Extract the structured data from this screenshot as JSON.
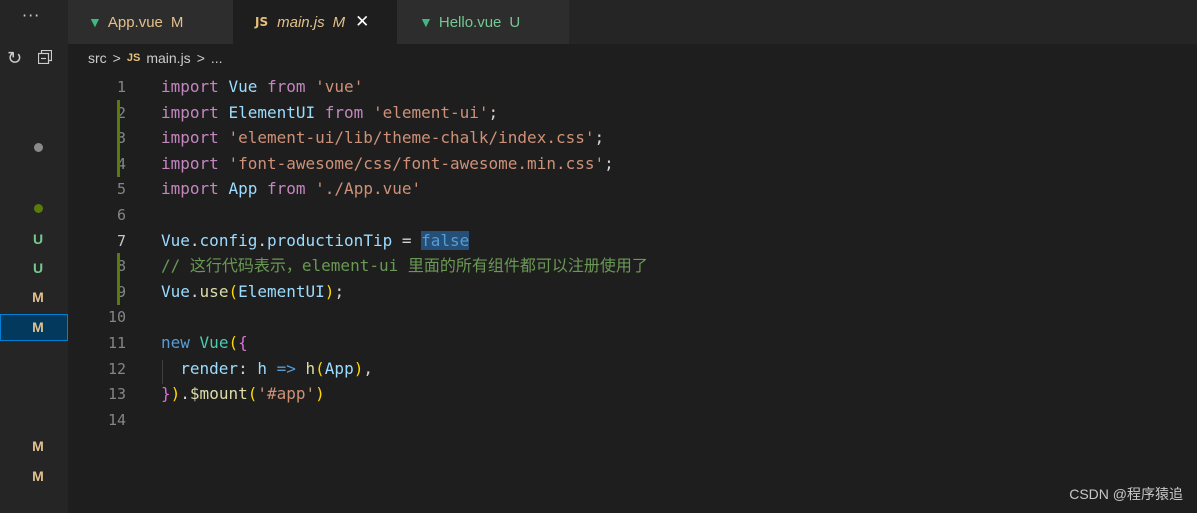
{
  "sidebar": {
    "more_label": "···",
    "refresh_glyph": "↻",
    "scm_decorations": [
      {
        "kind": "dot",
        "color": "#8a8a8a"
      },
      {
        "kind": "dot",
        "color": "#587c0c"
      },
      {
        "kind": "badge",
        "label": "U",
        "color": "#73c991"
      },
      {
        "kind": "badge",
        "label": "U",
        "color": "#73c991"
      },
      {
        "kind": "badge",
        "label": "M",
        "color": "#e2c08d"
      },
      {
        "kind": "badge",
        "label": "M",
        "color": "#e2c08d",
        "selected": true
      },
      {
        "kind": "badge",
        "label": "M",
        "color": "#e2c08d"
      },
      {
        "kind": "badge",
        "label": "M",
        "color": "#e2c08d"
      }
    ]
  },
  "tabs": [
    {
      "icon": "V",
      "label": "App.vue",
      "status": "M",
      "status_color": "#e2c08d",
      "label_color": "#e2c08d",
      "active": false
    },
    {
      "icon": "JS",
      "label": "main.js",
      "status": "M",
      "status_color": "#e2c08d",
      "label_color": "#e2c08d",
      "active": true,
      "close": "✕"
    },
    {
      "icon": "V",
      "label": "Hello.vue",
      "status": "U",
      "status_color": "#73c991",
      "label_color": "#73c991",
      "active": false
    }
  ],
  "breadcrumb": {
    "folder": "src",
    "sep": ">",
    "file_icon": "JS",
    "file": "main.js",
    "tail": "..."
  },
  "editor": {
    "active_line": 7,
    "selection": "false",
    "lines": [
      {
        "n": "1",
        "gutter": false,
        "tokens": [
          [
            "kw",
            "import"
          ],
          [
            "",
            " "
          ],
          [
            "var",
            "Vue"
          ],
          [
            "",
            " "
          ],
          [
            "kw",
            "from"
          ],
          [
            "",
            " "
          ],
          [
            "str",
            "'vue'"
          ]
        ]
      },
      {
        "n": "2",
        "gutter": true,
        "tokens": [
          [
            "kw",
            "import"
          ],
          [
            "",
            " "
          ],
          [
            "var",
            "ElementUI"
          ],
          [
            "",
            " "
          ],
          [
            "kw",
            "from"
          ],
          [
            "",
            " "
          ],
          [
            "str",
            "'element-ui'"
          ],
          [
            "",
            ";"
          ]
        ]
      },
      {
        "n": "3",
        "gutter": true,
        "tokens": [
          [
            "kw",
            "import"
          ],
          [
            "",
            " "
          ],
          [
            "str",
            "'element-ui/lib/theme-chalk/index.css'"
          ],
          [
            "",
            ";"
          ]
        ]
      },
      {
        "n": "4",
        "gutter": true,
        "tokens": [
          [
            "kw",
            "import"
          ],
          [
            "",
            " "
          ],
          [
            "str",
            "'font-awesome/css/font-awesome.min.css'"
          ],
          [
            "",
            ";"
          ]
        ]
      },
      {
        "n": "5",
        "gutter": false,
        "tokens": [
          [
            "kw",
            "import"
          ],
          [
            "",
            " "
          ],
          [
            "var",
            "App"
          ],
          [
            "",
            " "
          ],
          [
            "kw",
            "from"
          ],
          [
            "",
            " "
          ],
          [
            "str",
            "'./App.vue'"
          ]
        ]
      },
      {
        "n": "6",
        "gutter": false,
        "tokens": []
      },
      {
        "n": "7",
        "gutter": false,
        "tokens": [
          [
            "var",
            "Vue"
          ],
          [
            "",
            "."
          ],
          [
            "var",
            "config"
          ],
          [
            "",
            "."
          ],
          [
            "var",
            "productionTip"
          ],
          [
            "",
            " = "
          ],
          [
            "bool sel",
            "false"
          ]
        ]
      },
      {
        "n": "8",
        "gutter": true,
        "tokens": [
          [
            "cm",
            "// 这行代码表示，element-ui 里面的所有组件都可以注册使用了"
          ]
        ]
      },
      {
        "n": "9",
        "gutter": true,
        "tokens": [
          [
            "var",
            "Vue"
          ],
          [
            "",
            "."
          ],
          [
            "fn",
            "use"
          ],
          [
            "br1",
            "("
          ],
          [
            "var",
            "ElementUI"
          ],
          [
            "br1",
            ")"
          ],
          [
            "",
            ";"
          ]
        ]
      },
      {
        "n": "10",
        "gutter": false,
        "tokens": []
      },
      {
        "n": "11",
        "gutter": false,
        "tokens": [
          [
            "bool",
            "new"
          ],
          [
            "",
            " "
          ],
          [
            "cls",
            "Vue"
          ],
          [
            "br1",
            "("
          ],
          [
            "br2",
            "{"
          ]
        ]
      },
      {
        "n": "12",
        "gutter": false,
        "tokens": [
          [
            "",
            "  "
          ],
          [
            "var",
            "render"
          ],
          [
            "",
            ": "
          ],
          [
            "var",
            "h"
          ],
          [
            "",
            " "
          ],
          [
            "bool",
            "=>"
          ],
          [
            "",
            " "
          ],
          [
            "fn",
            "h"
          ],
          [
            "br1",
            "("
          ],
          [
            "var",
            "App"
          ],
          [
            "br1",
            ")"
          ],
          [
            "",
            ","
          ]
        ]
      },
      {
        "n": "13",
        "gutter": false,
        "tokens": [
          [
            "br2",
            "}"
          ],
          [
            "br1",
            ")"
          ],
          [
            "",
            "."
          ],
          [
            "fn",
            "$mount"
          ],
          [
            "br1",
            "("
          ],
          [
            "str",
            "'#app'"
          ],
          [
            "br1",
            ")"
          ]
        ]
      },
      {
        "n": "14",
        "gutter": false,
        "tokens": []
      }
    ]
  },
  "watermark": "CSDN @程序猿追"
}
